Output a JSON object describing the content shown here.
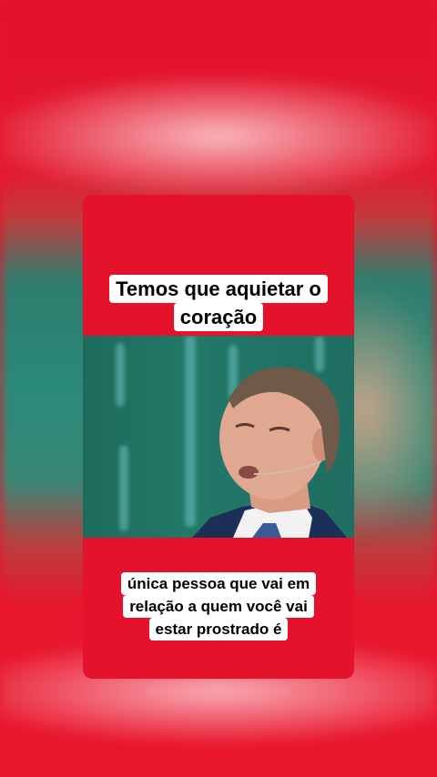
{
  "caption_top": {
    "lines": [
      "Temos que aquietar o",
      "coração"
    ]
  },
  "caption_bottom": {
    "lines": [
      "única pessoa que vai em",
      "relação a quem você vai",
      "estar prostrado é"
    ]
  },
  "colors": {
    "frame_red": "#e4122b",
    "caption_bg": "#ffffff",
    "caption_text": "#000000",
    "stage_teal": "#237868"
  }
}
